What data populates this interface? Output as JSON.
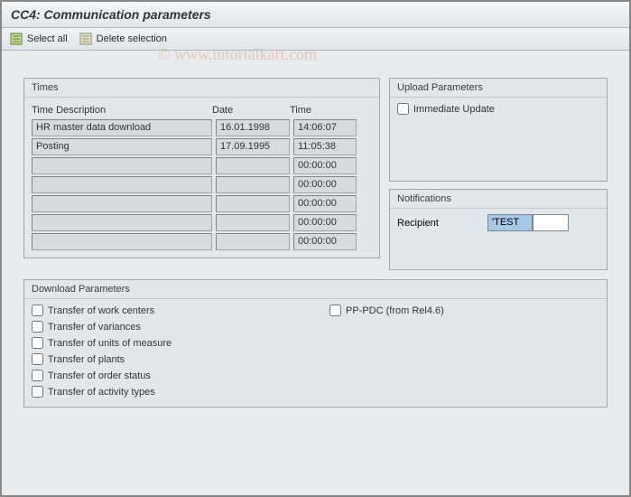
{
  "title": "CC4: Communication parameters",
  "toolbar": {
    "select_all": "Select all",
    "delete_selection": "Delete selection"
  },
  "watermark": "© www.tutorialkart.com",
  "times": {
    "title": "Times",
    "headers": {
      "desc": "Time Description",
      "date": "Date",
      "time": "Time"
    },
    "rows": [
      {
        "desc": "HR master data download",
        "date": "16.01.1998",
        "time": "14:06:07"
      },
      {
        "desc": "Posting",
        "date": "17.09.1995",
        "time": "11:05:38"
      },
      {
        "desc": "",
        "date": "",
        "time": "00:00:00"
      },
      {
        "desc": "",
        "date": "",
        "time": "00:00:00"
      },
      {
        "desc": "",
        "date": "",
        "time": "00:00:00"
      },
      {
        "desc": "",
        "date": "",
        "time": "00:00:00"
      },
      {
        "desc": "",
        "date": "",
        "time": "00:00:00"
      }
    ]
  },
  "upload": {
    "title": "Upload Parameters",
    "immediate_update": "Immediate Update"
  },
  "notifications": {
    "title": "Notifications",
    "recipient_label": "Recipient",
    "recipient_value": "'TEST"
  },
  "download": {
    "title": "Download Parameters",
    "items_left": [
      "Transfer of work centers",
      "Transfer of variances",
      "Transfer of units of measure",
      "Transfer of plants",
      "Transfer of order status",
      "Transfer of activity types"
    ],
    "item_right": "PP-PDC (from Rel4.6)"
  }
}
